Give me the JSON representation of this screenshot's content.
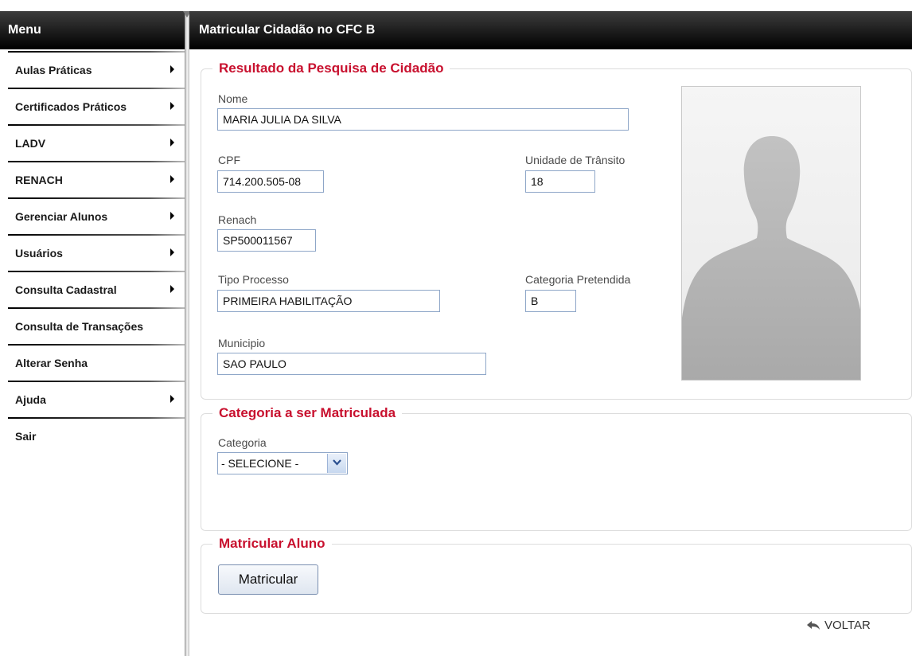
{
  "sidebar": {
    "title": "Menu",
    "items": [
      {
        "label": "Aulas Práticas",
        "arrow": true
      },
      {
        "label": "Certificados Práticos",
        "arrow": true
      },
      {
        "label": "LADV",
        "arrow": true
      },
      {
        "label": "RENACH",
        "arrow": true
      },
      {
        "label": "Gerenciar Alunos",
        "arrow": true
      },
      {
        "label": "Usuários",
        "arrow": true
      },
      {
        "label": "Consulta Cadastral",
        "arrow": true
      },
      {
        "label": "Consulta de Transações",
        "arrow": false
      },
      {
        "label": "Alterar Senha",
        "arrow": false
      },
      {
        "label": "Ajuda",
        "arrow": true
      },
      {
        "label": "Sair",
        "arrow": false
      }
    ]
  },
  "main": {
    "title": "Matricular Cidadão no CFC B",
    "resultado": {
      "legend": "Resultado da Pesquisa de Cidadão",
      "nome_label": "Nome",
      "nome_value": "MARIA JULIA DA SILVA",
      "cpf_label": "CPF",
      "cpf_value": "714.200.505-08",
      "unidade_label": "Unidade de Trânsito",
      "unidade_value": "18",
      "renach_label": "Renach",
      "renach_value": "SP500011567",
      "tipo_label": "Tipo Processo",
      "tipo_value": "PRIMEIRA HABILITAÇÃO",
      "categoria_pretendida_label": "Categoria Pretendida",
      "categoria_pretendida_value": "B",
      "municipio_label": "Municipio",
      "municipio_value": "SAO PAULO"
    },
    "categoria": {
      "legend": "Categoria a ser Matriculada",
      "label": "Categoria",
      "selected": "- SELECIONE -"
    },
    "matricular": {
      "legend": "Matricular Aluno",
      "button_label": "Matricular"
    },
    "voltar_label": "VOLTAR"
  },
  "colors": {
    "accent": "#c8102e",
    "header_bg": "#000000",
    "input_border": "#8ea6c8"
  },
  "icons": {
    "menu_arrow": "triangle-right-icon",
    "select": "chevron-down-icon",
    "back": "back-arrow-icon",
    "photo": "person-silhouette-icon"
  }
}
